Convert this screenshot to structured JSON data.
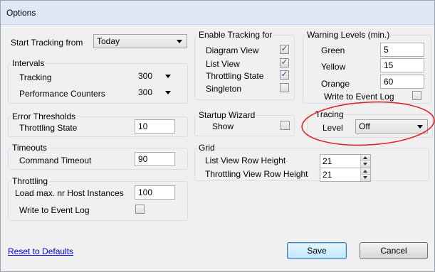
{
  "window": {
    "title": "Options"
  },
  "start_tracking": {
    "label": "Start Tracking from",
    "value": "Today"
  },
  "intervals": {
    "title": "Intervals",
    "tracking_label": "Tracking",
    "tracking_value": "300",
    "perf_label": "Performance Counters",
    "perf_value": "300"
  },
  "error_thresholds": {
    "title": "Error Thresholds",
    "throttling_label": "Throttling State",
    "throttling_value": "10"
  },
  "timeouts": {
    "title": "Timeouts",
    "command_label": "Command Timeout",
    "command_value": "90"
  },
  "throttling": {
    "title": "Throttling",
    "load_label": "Load max. nr Host Instances",
    "load_value": "100",
    "write_label": "Write to Event Log",
    "write_checked": false
  },
  "enable_tracking": {
    "title": "Enable Tracking for",
    "items": [
      {
        "label": "Diagram View",
        "checked": true
      },
      {
        "label": "List View",
        "checked": true
      },
      {
        "label": "Throttling State",
        "checked": true
      },
      {
        "label": "Singleton",
        "checked": false
      }
    ]
  },
  "startup_wizard": {
    "title": "Startup Wizard",
    "show_label": "Show",
    "show_checked": false
  },
  "grid": {
    "title": "Grid",
    "list_row_label": "List View Row Height",
    "list_row_value": "21",
    "throttling_row_label": "Throttling View Row Height",
    "throttling_row_value": "21"
  },
  "warning_levels": {
    "title": "Warning Levels (min.)",
    "green_label": "Green",
    "green_value": "5",
    "yellow_label": "Yellow",
    "yellow_value": "15",
    "orange_label": "Orange",
    "orange_value": "60",
    "write_label": "Write to Event Log",
    "write_checked": false
  },
  "tracing": {
    "title": "Tracing",
    "level_label": "Level",
    "level_value": "Off"
  },
  "footer": {
    "reset_label": "Reset to Defaults",
    "save_label": "Save",
    "cancel_label": "Cancel"
  },
  "colors": {
    "annotation": "#e0282a",
    "link": "#0000ee",
    "default_button_border": "#3c7fb1"
  },
  "icons": {
    "checkbox_check": "check-mark",
    "dropdown": "chevron-down",
    "spinner": "up-down-arrows"
  }
}
